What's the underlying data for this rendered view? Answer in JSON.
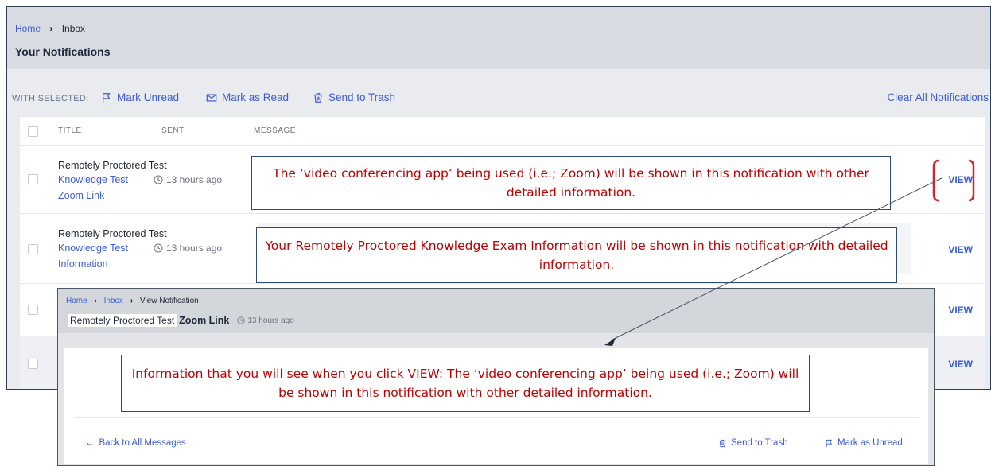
{
  "main": {
    "breadcrumb": {
      "home": "Home",
      "current": "Inbox"
    },
    "page_title": "Your Notifications",
    "toolbar": {
      "with_selected": "WITH SELECTED:",
      "mark_unread": "Mark Unread",
      "mark_read": "Mark as Read",
      "send_trash": "Send to Trash",
      "clear_all": "Clear All Notifications"
    },
    "columns": {
      "title": "TITLE",
      "sent": "SENT",
      "message": "MESSAGE"
    },
    "rows": [
      {
        "title_line1": "Remotely Proctored Test",
        "title_line2": "Knowledge Test",
        "title_line3": "Zoom Link",
        "sent": "13 hours ago",
        "action": "VIEW"
      },
      {
        "title_line1": "Remotely Proctored Test",
        "title_line2": "Knowledge Test",
        "title_line3": "Information",
        "sent": "13 hours ago",
        "action": "VIEW"
      },
      {
        "action": "VIEW"
      },
      {
        "action": "VIEW"
      }
    ]
  },
  "callouts": {
    "zoom": "The ‘video conferencing app’ being used (i.e.; Zoom) will be shown in this notification with other detailed information.",
    "exam": "Your Remotely Proctored Knowledge Exam Information will be shown in this notification with detailed information.",
    "view_info": "Information that you will see when you click VIEW:  The ‘video conferencing app’ being used (i.e.; Zoom) will be shown in this notification with other detailed information."
  },
  "detail": {
    "breadcrumb": {
      "home": "Home",
      "inbox": "Inbox",
      "current": "View Notification"
    },
    "subject_prefix": "Remotely Proctored Test",
    "subject": "Zoom Link",
    "time": "13 hours ago",
    "back": "Back to All Messages",
    "send_trash": "Send to Trash",
    "mark_unread": "Mark as Unread"
  },
  "colors": {
    "link": "#3b5bdb",
    "callout_text": "#c00000",
    "callout_border": "#2f4a7a",
    "highlight": "#e02020"
  },
  "icons": [
    "flag-icon",
    "envelope-icon",
    "trash-icon",
    "clock-icon",
    "arrow-left-icon"
  ]
}
